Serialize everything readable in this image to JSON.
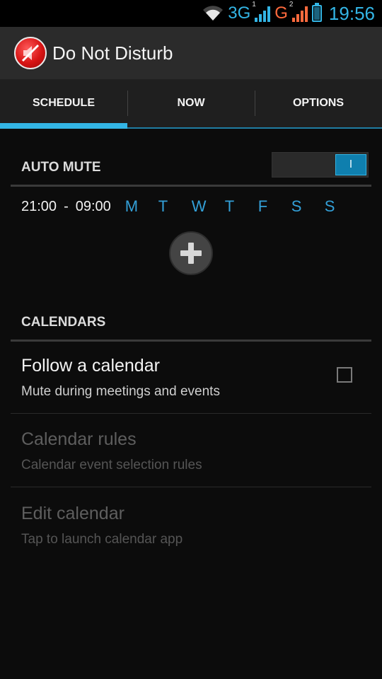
{
  "status_bar": {
    "network_1": "3G",
    "sim_1": "1",
    "network_2": "G",
    "sim_2": "2",
    "time": "19:56",
    "icons": [
      "wifi-icon",
      "signal-icon",
      "signal-icon",
      "battery-charging-icon"
    ]
  },
  "action_bar": {
    "title": "Do Not Disturb",
    "icon": "muted-speaker-icon"
  },
  "tabs": [
    {
      "label": "SCHEDULE",
      "active": true
    },
    {
      "label": "NOW",
      "active": false
    },
    {
      "label": "OPTIONS",
      "active": false
    }
  ],
  "auto_mute": {
    "header": "AUTO MUTE",
    "toggle_on": true,
    "toggle_text": "I",
    "schedule": {
      "start": "21:00",
      "separator": "-",
      "end": "09:00",
      "days": [
        "M",
        "T",
        "W",
        "T",
        "F",
        "S",
        "S"
      ]
    },
    "add_icon": "plus-icon"
  },
  "calendars": {
    "header": "CALENDARS",
    "items": [
      {
        "title": "Follow a calendar",
        "summary": "Mute during meetings and events",
        "enabled": true,
        "checked": false
      },
      {
        "title": "Calendar rules",
        "summary": "Calendar event selection rules",
        "enabled": false
      },
      {
        "title": "Edit calendar",
        "summary": "Tap to launch calendar app",
        "enabled": false
      }
    ]
  },
  "colors": {
    "accent": "#33b5e5",
    "background": "#0c0c0c",
    "action_bar": "#2b2b2b",
    "tab_bar": "#1f1f1f",
    "app_icon_red": "#d71414"
  }
}
